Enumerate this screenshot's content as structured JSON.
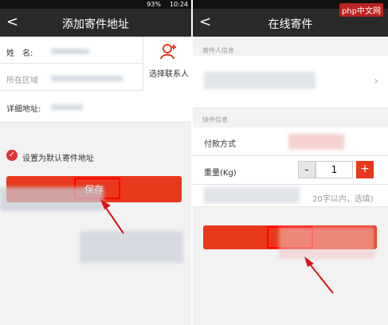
{
  "left": {
    "status": {
      "battery": "93%",
      "time": "10:24"
    },
    "title": "添加寄件地址",
    "back": "<",
    "fields": {
      "name_label": "姓　名:",
      "location_label": "所在区域",
      "address_label": "详细地址:"
    },
    "contact_label": "选择联系人",
    "default_label": "设置为默认寄件地址",
    "save_label": "保存"
  },
  "right": {
    "title": "在线寄件",
    "back": "<",
    "section_sender": "寄件人信息",
    "section_package": "快件信息",
    "payment_label": "付款方式",
    "weight_label": "重量(Kg)",
    "weight_value": "1",
    "minus": "-",
    "plus": "+",
    "note_hint": "20字以内，选填)",
    "logo": "php中文网"
  }
}
